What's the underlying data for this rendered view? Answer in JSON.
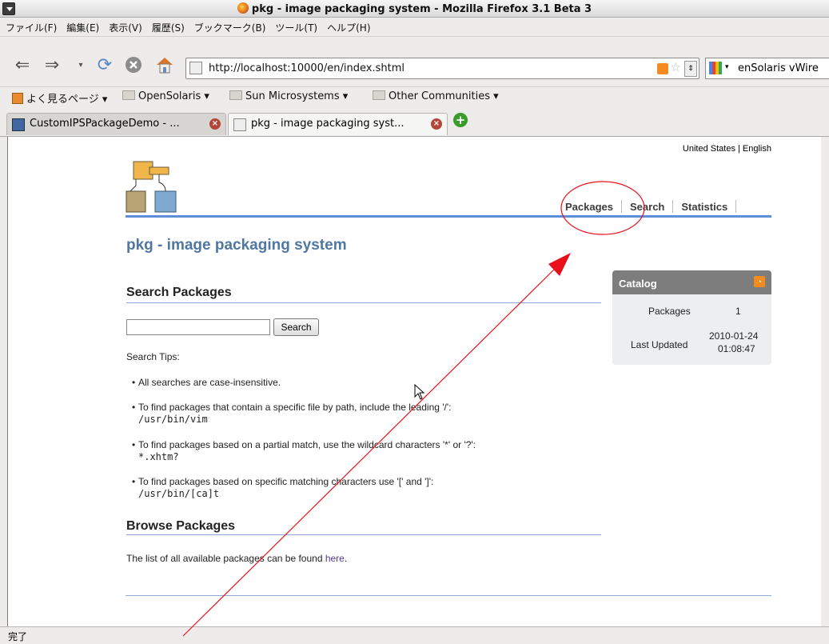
{
  "window": {
    "title": "pkg - image packaging system - Mozilla Firefox 3.1 Beta 3"
  },
  "menu": [
    "ファイル(F)",
    "編集(E)",
    "表示(V)",
    "履歴(S)",
    "ブックマーク(B)",
    "ツール(T)",
    "ヘルプ(H)"
  ],
  "navbar": {
    "url": "http://localhost:10000/en/index.shtml",
    "search_text": "enSolaris vWire"
  },
  "bookmarks": [
    "よく見るページ ▾",
    "OpenSolaris ▾",
    "Sun Microsystems ▾",
    "Other Communities ▾"
  ],
  "tabs": [
    {
      "label": "CustomIPSPackageDemo - ..."
    },
    {
      "label": "pkg - image packaging syst..."
    }
  ],
  "page": {
    "locale": "United States | English",
    "nav": [
      "Packages",
      "Search",
      "Statistics"
    ],
    "title": "pkg - image packaging system",
    "search_heading": "Search Packages",
    "search_button": "Search",
    "tips_label": "Search Tips:",
    "tips": [
      {
        "text": "All searches are case-insensitive.",
        "code": ""
      },
      {
        "text": "To find packages that contain a specific file by path, include the leading '/':",
        "code": "/usr/bin/vim"
      },
      {
        "text": "To find packages based on a partial match, use the wildcard characters '*' or '?':",
        "code": "*.xhtm?"
      },
      {
        "text": "To find packages based on specific matching characters use '[' and ']':",
        "code": "/usr/bin/[ca]t"
      }
    ],
    "browse_heading": "Browse Packages",
    "browse_text": "The list of all available packages can be found ",
    "browse_link": "here",
    "browse_end": "."
  },
  "catalog": {
    "title": "Catalog",
    "packages_label": "Packages",
    "packages_value": "1",
    "updated_label": "Last Updated",
    "updated_date": "2010-01-24",
    "updated_time": "01:08:47"
  },
  "status": "完了",
  "colors": {
    "annotation": "#e8101a",
    "accent": "#5c8fd7",
    "title": "#5077a4"
  }
}
